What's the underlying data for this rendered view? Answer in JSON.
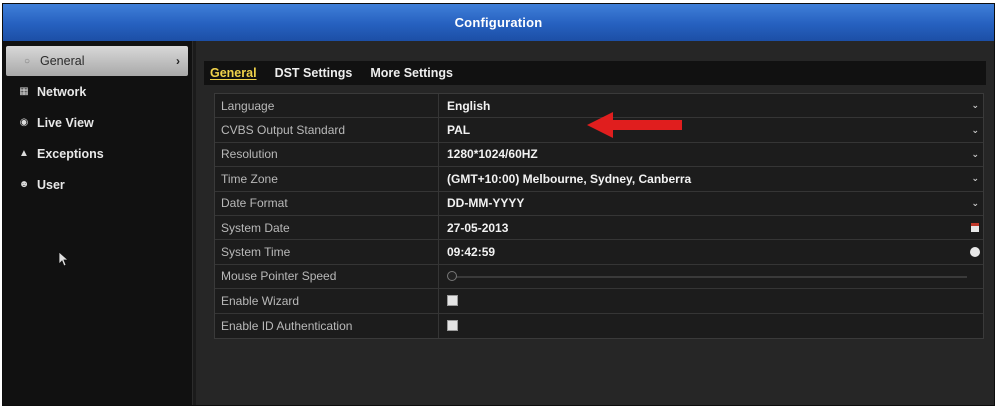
{
  "window": {
    "title": "Configuration"
  },
  "sidebar": {
    "items": [
      {
        "label": "General",
        "icon": "gear-icon",
        "active": true
      },
      {
        "label": "Network",
        "icon": "network-icon"
      },
      {
        "label": "Live View",
        "icon": "eye-icon"
      },
      {
        "label": "Exceptions",
        "icon": "warning-icon"
      },
      {
        "label": "User",
        "icon": "users-icon"
      }
    ]
  },
  "tabs": [
    {
      "label": "General",
      "active": true
    },
    {
      "label": "DST Settings"
    },
    {
      "label": "More Settings"
    }
  ],
  "form": {
    "language": {
      "label": "Language",
      "value": "English"
    },
    "cvbs": {
      "label": "CVBS Output Standard",
      "value": "PAL"
    },
    "resolution": {
      "label": "Resolution",
      "value": "1280*1024/60HZ"
    },
    "timezone": {
      "label": "Time Zone",
      "value": "(GMT+10:00) Melbourne, Sydney, Canberra"
    },
    "date_format": {
      "label": "Date Format",
      "value": "DD-MM-YYYY"
    },
    "system_date": {
      "label": "System Date",
      "value": "27-05-2013"
    },
    "system_time": {
      "label": "System Time",
      "value": "09:42:59"
    },
    "mouse_speed": {
      "label": "Mouse Pointer Speed",
      "value_fraction": 0
    },
    "wizard": {
      "label": "Enable Wizard",
      "checked": false
    },
    "id_auth": {
      "label": "Enable ID Authentication",
      "checked": false
    }
  },
  "colors": {
    "title_bar": "#2660bf",
    "active_tab": "#f0d24a",
    "annotation_arrow": "#e01e1e"
  }
}
